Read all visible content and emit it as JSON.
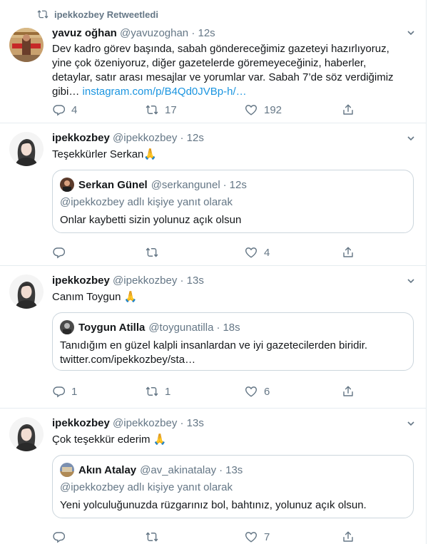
{
  "retweet_label": "ipekkozbey Retweetledi",
  "tweets": [
    {
      "name": "yavuz oğhan",
      "handle": "@yavuzoghan",
      "time": "12s",
      "text_lines": [
        "Dev kadro görev başında, sabah göndereceğimiz gazeteyi hazırlıyoruz,",
        "yine çok özeniyoruz, diğer gazetelerde göremeyeceğiniz, haberler,",
        "detaylar, satır arası mesajlar ve yorumlar var. Sabah 7’de söz verdiğimiz"
      ],
      "text_last": "gibi… ",
      "link": "instagram.com/p/B4Qd0JVBp-h/…",
      "replies": "4",
      "retweets": "17",
      "likes": "192"
    },
    {
      "name": "ipekkozbey",
      "handle": "@ipekkozbey",
      "time": "12s",
      "text": "Teşekkürler Serkan🙏",
      "quote": {
        "name": "Serkan Günel",
        "handle": "@serkangunel",
        "time": "12s",
        "reply_to": "@ipekkozbey adlı kişiye yanıt olarak",
        "text": "Onlar kaybetti sizin yolunuz açık olsun"
      },
      "replies": "",
      "retweets": "",
      "likes": "4"
    },
    {
      "name": "ipekkozbey",
      "handle": "@ipekkozbey",
      "time": "13s",
      "text": "Canım Toygun 🙏",
      "quote": {
        "name": "Toygun Atilla",
        "handle": "@toygunatilla",
        "time": "18s",
        "text_line1": "Tanıdığım en güzel kalpli insanlardan ve iyi gazetecilerden biridir.",
        "text_line2": "twitter.com/ipekkozbey/sta…"
      },
      "replies": "1",
      "retweets": "1",
      "likes": "6"
    },
    {
      "name": "ipekkozbey",
      "handle": "@ipekkozbey",
      "time": "13s",
      "text": "Çok teşekkür ederim 🙏",
      "quote": {
        "name": "Akın Atalay",
        "handle": "@av_akinatalay",
        "time": "13s",
        "reply_to": "@ipekkozbey adlı kişiye yanıt olarak",
        "text": "Yeni yolculuğunuzda rüzgarınız bol, bahtınız, yolunuz açık olsun."
      },
      "replies": "",
      "retweets": "",
      "likes": "7"
    }
  ],
  "icons": {
    "reply": "reply-icon",
    "retweet": "retweet-icon",
    "like": "heart-icon",
    "share": "share-icon",
    "more": "chevron-down-icon"
  },
  "colors": {
    "text": "#14171a",
    "secondary": "#657786",
    "link": "#1b95e0",
    "border": "#e6ecf0"
  }
}
